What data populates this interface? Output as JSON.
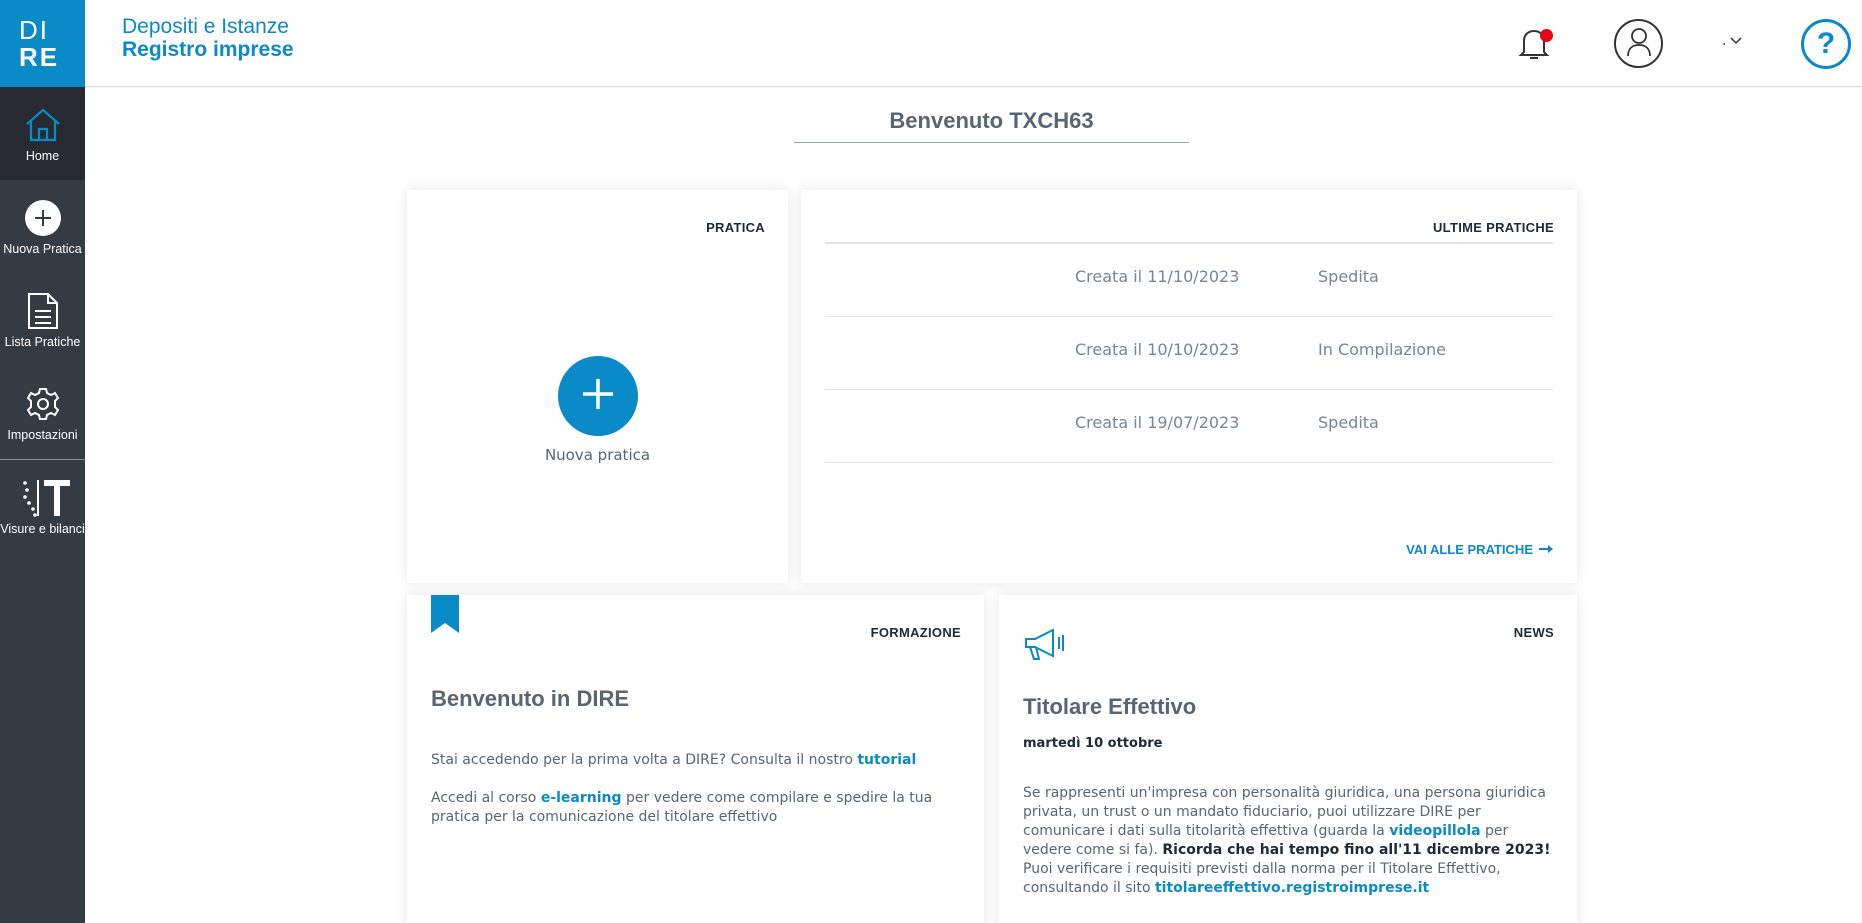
{
  "logo": {
    "line1": "DI",
    "line2": "RE"
  },
  "brand": {
    "line1": "Depositi e Istanze",
    "line2": "Registro imprese"
  },
  "sidebar": {
    "items": [
      {
        "label": "Home"
      },
      {
        "label": "Nuova Pratica"
      },
      {
        "label": "Lista Pratiche"
      },
      {
        "label": "Impostazioni"
      },
      {
        "label": "Visure e bilanci"
      }
    ]
  },
  "header": {
    "user_name": ".",
    "help_label": "?"
  },
  "welcome": "Benvenuto TXCH63",
  "pratica": {
    "title": "PRATICA",
    "new_label": "Nuova pratica"
  },
  "ultime": {
    "title": "ULTIME PRATICHE",
    "rows": [
      {
        "date": "Creata il 11/10/2023",
        "status": "Spedita"
      },
      {
        "date": "Creata il 10/10/2023",
        "status": "In Compilazione"
      },
      {
        "date": "Creata il 19/07/2023",
        "status": "Spedita"
      }
    ],
    "link": "VAI ALLE PRATICHE"
  },
  "formazione": {
    "title": "FORMAZIONE",
    "heading": "Benvenuto in DIRE",
    "p1_text": "Stai accedendo per la prima volta a DIRE? Consulta il nostro",
    "p1_link": "tutorial",
    "p2_pre": "Accedi al corso",
    "p2_link": "e-learning",
    "p2_post": "per vedere come compilare e spedire la tua pratica per la comunicazione del titolare effettivo"
  },
  "news": {
    "title": "NEWS",
    "heading": "Titolare Effettivo",
    "date": "martedì 10 ottobre",
    "p1_pre": "Se rappresenti un'impresa con personalità giuridica, una persona giuridica privata, un trust o un mandato fiduciario, puoi utilizzare DIRE per comunicare i dati sulla titolarità effettiva (guarda la",
    "p1_link": "videopillola",
    "p1_post": "per vedere come si fa).",
    "p1_bold": "Ricorda che hai tempo fino all'11 dicembre 2023!",
    "p2_pre": "Puoi verificare i requisiti previsti dalla norma per il Titolare Effettivo, consultando il sito",
    "p2_link": "titolareeffettivo.registroimprese.it"
  },
  "colors": {
    "accent": "#0a8ac6",
    "sidebar": "#353b43",
    "notification": "#e30613"
  }
}
